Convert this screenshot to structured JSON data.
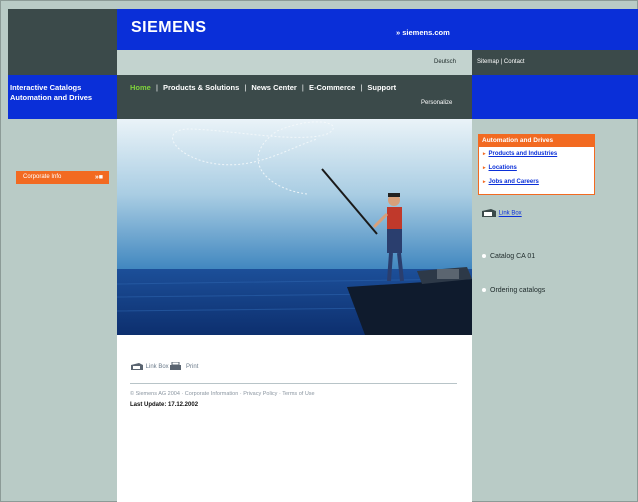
{
  "brand": {
    "logo": "SIEMENS",
    "site_link": "» siemens.com"
  },
  "left": {
    "title_line1": "Interactive Catalogs",
    "title_line2": "Automation and Drives",
    "corporate_label": "Corporate Info",
    "corporate_arrow": "»■"
  },
  "lang_bar": {
    "language": "Deutsch",
    "utility": "Sitemap | Contact"
  },
  "nav": {
    "items": [
      "Home",
      "Products & Solutions",
      "News Center",
      "E-Commerce",
      "Support"
    ],
    "separator": "|",
    "personalize": "Personalize"
  },
  "content": {
    "link_box": "Link Box",
    "print": "Print",
    "footer": "© Siemens AG 2004 · Corporate Information · Privacy Policy · Terms of Use",
    "last_update": "Last Update: 17.12.2002"
  },
  "right": {
    "box_title": "Automation and Drives",
    "box_items": [
      "Products and Industries",
      "Locations",
      "Jobs and Careers"
    ],
    "link_box": "Link Box",
    "side_items": [
      "Catalog CA 01",
      "Ordering catalogs"
    ]
  },
  "colors": {
    "brand_blue": "#0a2fd8",
    "dark_slate": "#3b4a4a",
    "accent_orange": "#f26a21",
    "nav_active": "#7fd33b",
    "page_bg": "#b9cbc6"
  }
}
